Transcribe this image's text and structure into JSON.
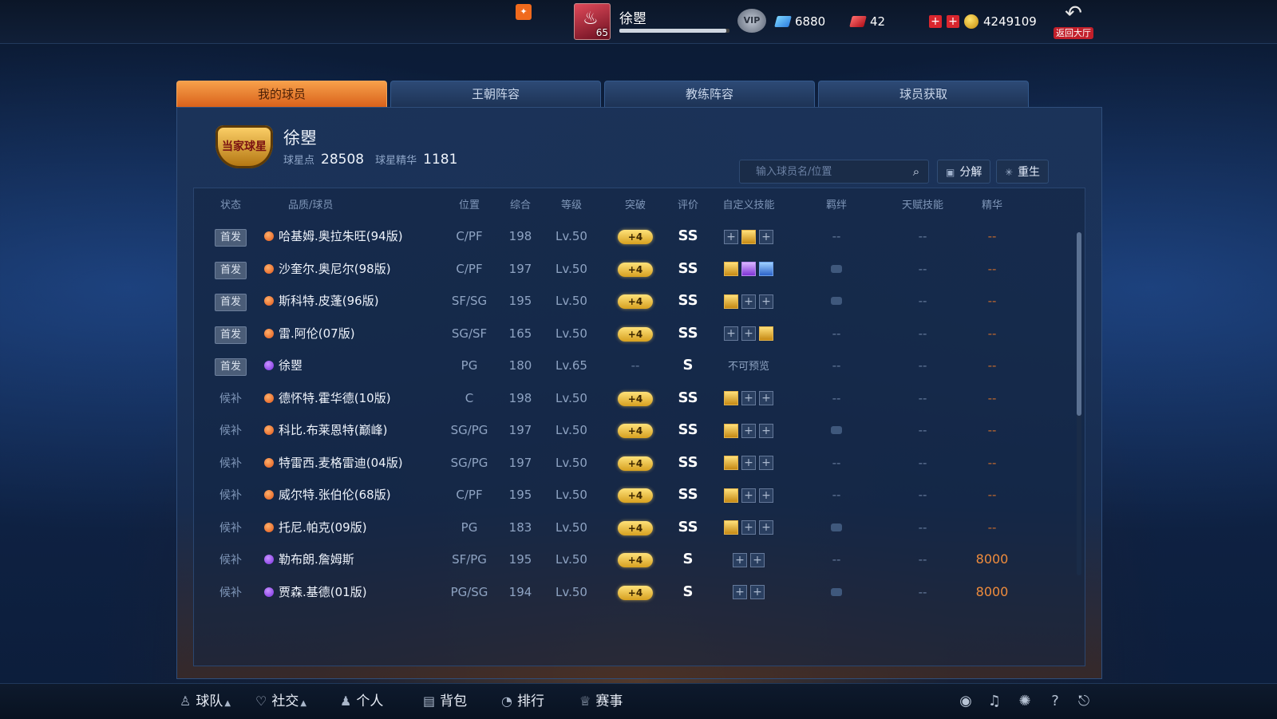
{
  "topbar": {
    "player_level": "65",
    "player_name": "徐瞾",
    "exp_fraction": 0.97,
    "vip_label": "VIP",
    "diamonds": "6880",
    "tickets": "42",
    "coins": "4249109",
    "back_label": "返回大厅"
  },
  "tabs": [
    "我的球员",
    "王朝阵容",
    "教练阵容",
    "球员获取"
  ],
  "profile": {
    "badge_text": "当家球星",
    "name": "徐瞾",
    "points_label": "球星点",
    "points": "28508",
    "essence_label": "球星精华",
    "essence": "1181"
  },
  "toolbar": {
    "search_placeholder": "输入球员名/位置",
    "decompose_label": "分解",
    "rebirth_label": "重生"
  },
  "table": {
    "headers": {
      "status": "状态",
      "name": "品质/球员",
      "pos": "位置",
      "ovr": "综合",
      "lv": "等级",
      "brk": "突破",
      "rate": "评价",
      "skill": "自定义技能",
      "bond": "羁绊",
      "talent": "天赋技能",
      "ess": "精华"
    },
    "rows": [
      {
        "status": "首发",
        "starter": true,
        "quality": "orange",
        "name": "哈基姆.奥拉朱旺(94版)",
        "pos": "C/PF",
        "ovr": "198",
        "lv": "Lv.50",
        "brk": "+4",
        "rate": "SS",
        "skills": [
          "plain",
          "gold",
          "plain"
        ],
        "bond": "--",
        "talent": "--",
        "ess": "--"
      },
      {
        "status": "首发",
        "starter": true,
        "quality": "orange",
        "name": "沙奎尔.奥尼尔(98版)",
        "pos": "C/PF",
        "ovr": "197",
        "lv": "Lv.50",
        "brk": "+4",
        "rate": "SS",
        "skills": [
          "gold",
          "purple",
          "blue"
        ],
        "bond": "icon",
        "talent": "--",
        "ess": "--"
      },
      {
        "status": "首发",
        "starter": true,
        "quality": "orange",
        "name": "斯科特.皮蓬(96版)",
        "pos": "SF/SG",
        "ovr": "195",
        "lv": "Lv.50",
        "brk": "+4",
        "rate": "SS",
        "skills": [
          "gold",
          "plain",
          "plain"
        ],
        "bond": "icon",
        "talent": "--",
        "ess": "--"
      },
      {
        "status": "首发",
        "starter": true,
        "quality": "orange",
        "name": "雷.阿伦(07版)",
        "pos": "SG/SF",
        "ovr": "165",
        "lv": "Lv.50",
        "brk": "+4",
        "rate": "SS",
        "skills": [
          "plain",
          "plain",
          "gold"
        ],
        "bond": "--",
        "talent": "--",
        "ess": "--"
      },
      {
        "status": "首发",
        "starter": true,
        "quality": "purple",
        "name": "徐瞾",
        "pos": "PG",
        "ovr": "180",
        "lv": "Lv.65",
        "brk": "--",
        "rate": "S",
        "skills": "不可预览",
        "bond": "--",
        "talent": "--",
        "ess": "--"
      },
      {
        "status": "候补",
        "starter": false,
        "quality": "orange",
        "name": "德怀特.霍华德(10版)",
        "pos": "C",
        "ovr": "198",
        "lv": "Lv.50",
        "brk": "+4",
        "rate": "SS",
        "skills": [
          "gold",
          "plain",
          "plain"
        ],
        "bond": "--",
        "talent": "--",
        "ess": "--"
      },
      {
        "status": "候补",
        "starter": false,
        "quality": "orange",
        "name": "科比.布莱恩特(巅峰)",
        "pos": "SG/PG",
        "ovr": "197",
        "lv": "Lv.50",
        "brk": "+4",
        "rate": "SS",
        "skills": [
          "gold",
          "plain",
          "plain"
        ],
        "bond": "icon",
        "talent": "--",
        "ess": "--"
      },
      {
        "status": "候补",
        "starter": false,
        "quality": "orange",
        "name": "特雷西.麦格雷迪(04版)",
        "pos": "SG/PG",
        "ovr": "197",
        "lv": "Lv.50",
        "brk": "+4",
        "rate": "SS",
        "skills": [
          "gold",
          "plain",
          "plain"
        ],
        "bond": "--",
        "talent": "--",
        "ess": "--"
      },
      {
        "status": "候补",
        "starter": false,
        "quality": "orange",
        "name": "威尔特.张伯伦(68版)",
        "pos": "C/PF",
        "ovr": "195",
        "lv": "Lv.50",
        "brk": "+4",
        "rate": "SS",
        "skills": [
          "gold",
          "plain",
          "plain"
        ],
        "bond": "--",
        "talent": "--",
        "ess": "--"
      },
      {
        "status": "候补",
        "starter": false,
        "quality": "orange",
        "name": "托尼.帕克(09版)",
        "pos": "PG",
        "ovr": "183",
        "lv": "Lv.50",
        "brk": "+4",
        "rate": "SS",
        "skills": [
          "gold",
          "plain",
          "plain"
        ],
        "bond": "icon",
        "talent": "--",
        "ess": "--"
      },
      {
        "status": "候补",
        "starter": false,
        "quality": "purple",
        "name": "勒布朗.詹姆斯",
        "pos": "SF/PG",
        "ovr": "195",
        "lv": "Lv.50",
        "brk": "+4",
        "rate": "S",
        "skills": [
          "plain",
          "plain"
        ],
        "bond": "--",
        "talent": "--",
        "ess": "8000"
      },
      {
        "status": "候补",
        "starter": false,
        "quality": "purple",
        "name": "贾森.基德(01版)",
        "pos": "PG/SG",
        "ovr": "194",
        "lv": "Lv.50",
        "brk": "+4",
        "rate": "S",
        "skills": [
          "plain",
          "plain"
        ],
        "bond": "icon",
        "talent": "--",
        "ess": "8000"
      }
    ]
  },
  "bottomnav": [
    "球队",
    "社交",
    "个人",
    "背包",
    "排行",
    "赛事"
  ],
  "colors": {
    "tab_active": "#e07a2c",
    "essence_value": "#f08c3c",
    "break_pill": "#f2c94c"
  }
}
